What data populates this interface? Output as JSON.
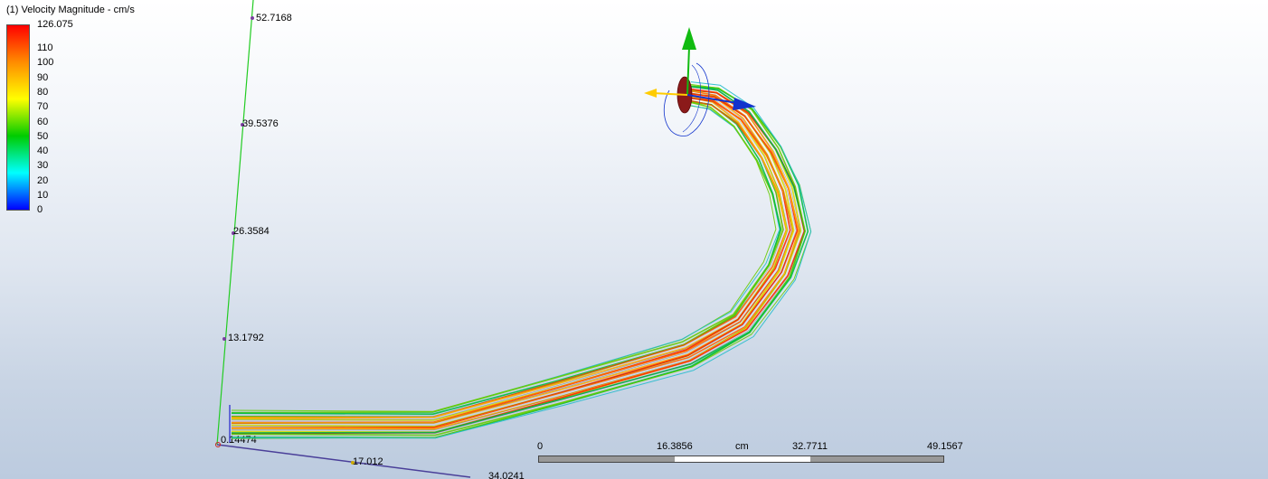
{
  "legend": {
    "title": "(1) Velocity Magnitude - cm/s",
    "max_label": "126.075",
    "ticks": [
      "110",
      "100",
      "90",
      "80",
      "70",
      "60",
      "50",
      "40",
      "30",
      "20",
      "10",
      "0"
    ],
    "colors": [
      "#ff0000",
      "#ff8c00",
      "#ffff00",
      "#00cc00",
      "#00ffff",
      "#0000ff"
    ]
  },
  "axes": {
    "vertical_labels": [
      "52.7168",
      "39.5376",
      "26.3584",
      "13.1792",
      "0.14474"
    ],
    "horizontal_labels": [
      "17.012",
      "34.0241"
    ],
    "vertical_color": "#22cc22",
    "horizontal_color": "#4a3f99"
  },
  "scale_bar": {
    "labels": [
      "0",
      "16.3856",
      "cm",
      "32.7711",
      "49.1567"
    ]
  },
  "triad": {
    "colors": [
      "#11bb11",
      "#1133cc",
      "#ffcc00",
      "#8b1a1a"
    ]
  }
}
